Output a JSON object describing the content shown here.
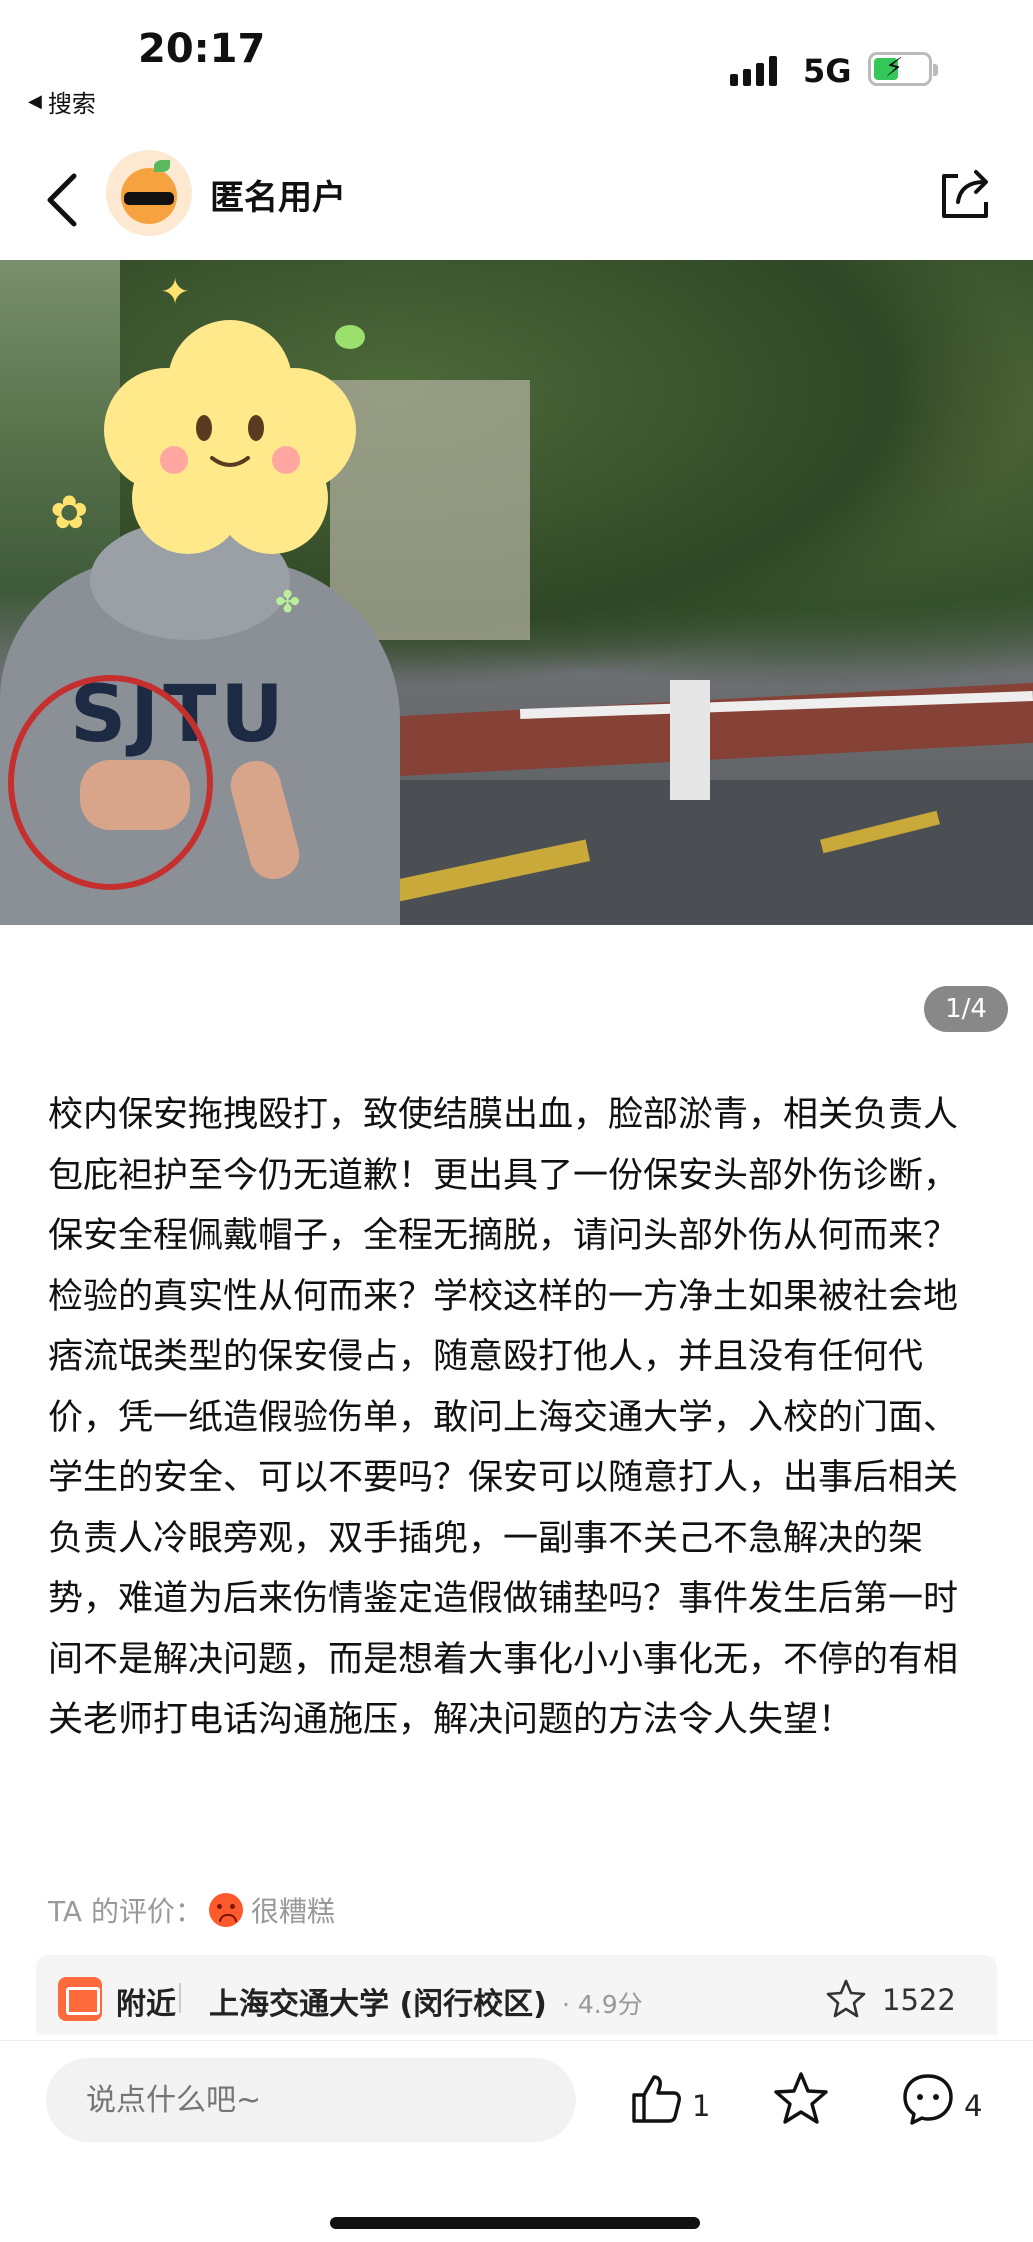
{
  "status_bar": {
    "time": "20:17",
    "back_app": "搜索",
    "network": "5G"
  },
  "nav": {
    "title": "匿名用户"
  },
  "photo": {
    "sweater_text": "SJTU",
    "counter": "1/4"
  },
  "post": {
    "content": "校内保安拖拽殴打，致使结膜出血，脸部淤青，相关负责人包庇袒护至今仍无道歉！更出具了一份保安头部外伤诊断，保安全程佩戴帽子，全程无摘脱，请问头部外伤从何而来？检验的真实性从何而来？学校这样的一方净土如果被社会地痞流氓类型的保安侵占，随意殴打他人，并且没有任何代价，凭一纸造假验伤单，敢问上海交通大学，入校的门面、学生的安全、可以不要吗？保安可以随意打人，出事后相关负责人冷眼旁观，双手插兜，一副事不关己不急解决的架势，难道为后来伤情鉴定造假做铺垫吗？事件发生后第一时间不是解决问题，而是想着大事化小小事化无，不停的有相关老师打电话沟通施压，解决问题的方法令人失望！",
    "rating_label": "TA 的评价：",
    "rating_value": "很糟糕"
  },
  "location": {
    "near_label": "附近",
    "name": "上海交通大学 (闵行校区)",
    "score": "· 4.9分",
    "favorites": "1522"
  },
  "bottom_bar": {
    "comment_placeholder": "说点什么吧~",
    "likes": "1",
    "comments": "4"
  },
  "colors": {
    "accent": "#ff6a3d",
    "rating_emoji": "#ff5a2c",
    "circle_annotation": "#c5302e"
  },
  "icons": [
    "back-arrow-icon",
    "share-icon",
    "star-icon",
    "like-icon",
    "comment-icon",
    "location-icon"
  ]
}
